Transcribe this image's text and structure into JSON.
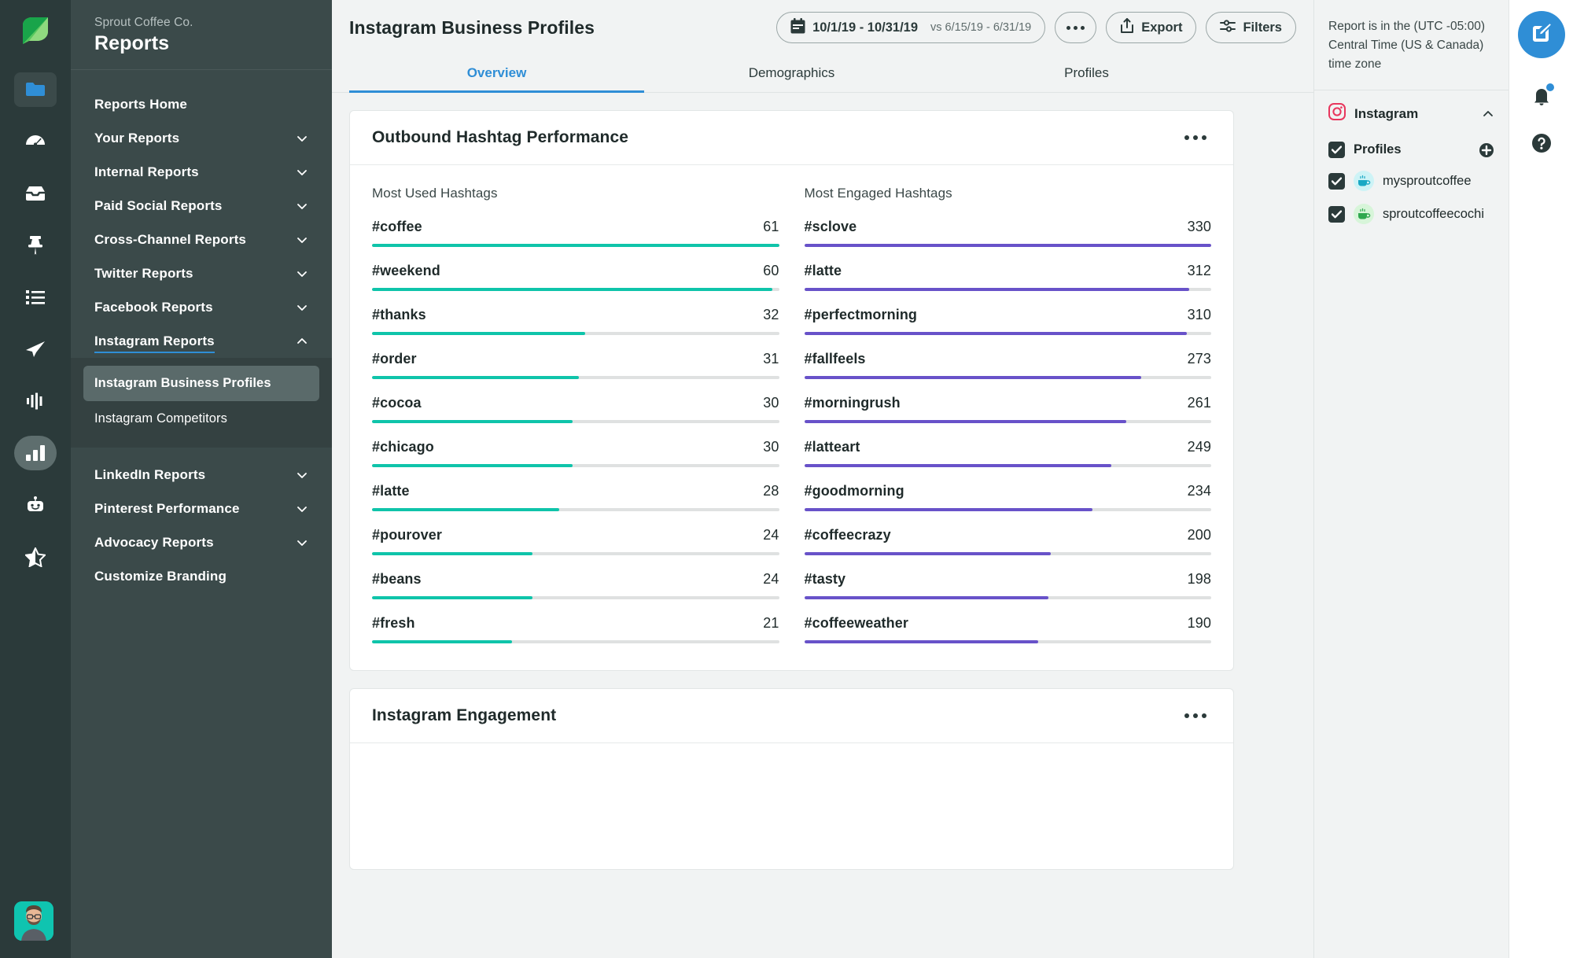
{
  "rail": {
    "logo_name": "sprout-leaf-logo",
    "icons": [
      {
        "name": "folder-icon",
        "active": true
      },
      {
        "name": "dashboard-gauge-icon",
        "active": false
      },
      {
        "name": "inbox-icon",
        "active": false
      },
      {
        "name": "pin-icon",
        "active": false
      },
      {
        "name": "list-icon",
        "active": false
      },
      {
        "name": "publish-send-icon",
        "active": false
      },
      {
        "name": "listening-waveform-icon",
        "active": false
      },
      {
        "name": "bar-chart-reports-icon",
        "active": true
      },
      {
        "name": "bot-icon",
        "active": false
      },
      {
        "name": "star-icon",
        "active": false
      }
    ]
  },
  "sidebar": {
    "org": "Sprout Coffee Co.",
    "title": "Reports",
    "items": [
      {
        "label": "Reports Home",
        "expandable": false
      },
      {
        "label": "Your Reports",
        "expandable": true,
        "chevron": "down"
      },
      {
        "label": "Internal Reports",
        "expandable": true,
        "chevron": "down"
      },
      {
        "label": "Paid Social Reports",
        "expandable": true,
        "chevron": "down"
      },
      {
        "label": "Cross-Channel Reports",
        "expandable": true,
        "chevron": "down"
      },
      {
        "label": "Twitter Reports",
        "expandable": true,
        "chevron": "down"
      },
      {
        "label": "Facebook Reports",
        "expandable": true,
        "chevron": "down"
      },
      {
        "label": "Instagram Reports",
        "expandable": true,
        "chevron": "up",
        "active": true
      }
    ],
    "submenu": [
      {
        "label": "Instagram Business Profiles",
        "selected": true
      },
      {
        "label": "Instagram Competitors",
        "selected": false
      }
    ],
    "items_after": [
      {
        "label": "LinkedIn Reports",
        "expandable": true,
        "chevron": "down"
      },
      {
        "label": "Pinterest Performance",
        "expandable": true,
        "chevron": "down"
      },
      {
        "label": "Advocacy Reports",
        "expandable": true,
        "chevron": "down"
      },
      {
        "label": "Customize Branding",
        "expandable": false
      }
    ]
  },
  "header": {
    "title": "Instagram Business Profiles",
    "date_range": "10/1/19 -  10/31/19",
    "date_compare": "vs 6/15/19 - 6/31/19",
    "more_label": "",
    "export_label": "Export",
    "filters_label": "Filters"
  },
  "tabs": [
    {
      "label": "Overview",
      "active": true
    },
    {
      "label": "Demographics",
      "active": false
    },
    {
      "label": "Profiles",
      "active": false
    }
  ],
  "cards": [
    {
      "title": "Outbound Hashtag Performance"
    },
    {
      "title": "Instagram Engagement"
    }
  ],
  "colors": {
    "teal": "#0fc4aa",
    "purple": "#6852c9",
    "track": "#dfe1e1",
    "accent_blue": "#2f8ed6",
    "instagram_pink": "#e8365d"
  },
  "chart_data": [
    {
      "type": "bar",
      "title": "Most Used Hashtags",
      "orientation": "horizontal",
      "color": "#0fc4aa",
      "max": 61,
      "categories": [
        "#coffee",
        "#weekend",
        "#thanks",
        "#order",
        "#cocoa",
        "#chicago",
        "#latte",
        "#pourover",
        "#beans",
        "#fresh"
      ],
      "values": [
        61,
        60,
        32,
        31,
        30,
        30,
        28,
        24,
        24,
        21
      ],
      "xlabel": "",
      "ylabel": "",
      "grid": false,
      "legend": false
    },
    {
      "type": "bar",
      "title": "Most Engaged Hashtags",
      "orientation": "horizontal",
      "color": "#6852c9",
      "max": 330,
      "categories": [
        "#sclove",
        "#latte",
        "#perfectmorning",
        "#fallfeels",
        "#morningrush",
        "#latteart",
        "#goodmorning",
        "#coffeecrazy",
        "#tasty",
        "#coffeeweather"
      ],
      "values": [
        330,
        312,
        310,
        273,
        261,
        249,
        234,
        200,
        198,
        190
      ],
      "xlabel": "",
      "ylabel": "",
      "grid": false,
      "legend": false
    }
  ],
  "right_panel": {
    "note": "Report is in the (UTC -05:00) Central Time (US & Canada) time zone",
    "network": "Instagram",
    "profiles_label": "Profiles",
    "profiles": [
      {
        "name": "mysproutcoffee",
        "avatar_bg": "#cdf3f6",
        "checked": true
      },
      {
        "name": "sproutcoffeecochi",
        "avatar_bg": "#d7f5d9",
        "checked": true
      }
    ]
  },
  "far_rail": {
    "compose_name": "compose-button",
    "bell_name": "notifications-bell-icon",
    "help_name": "help-circle-icon"
  }
}
